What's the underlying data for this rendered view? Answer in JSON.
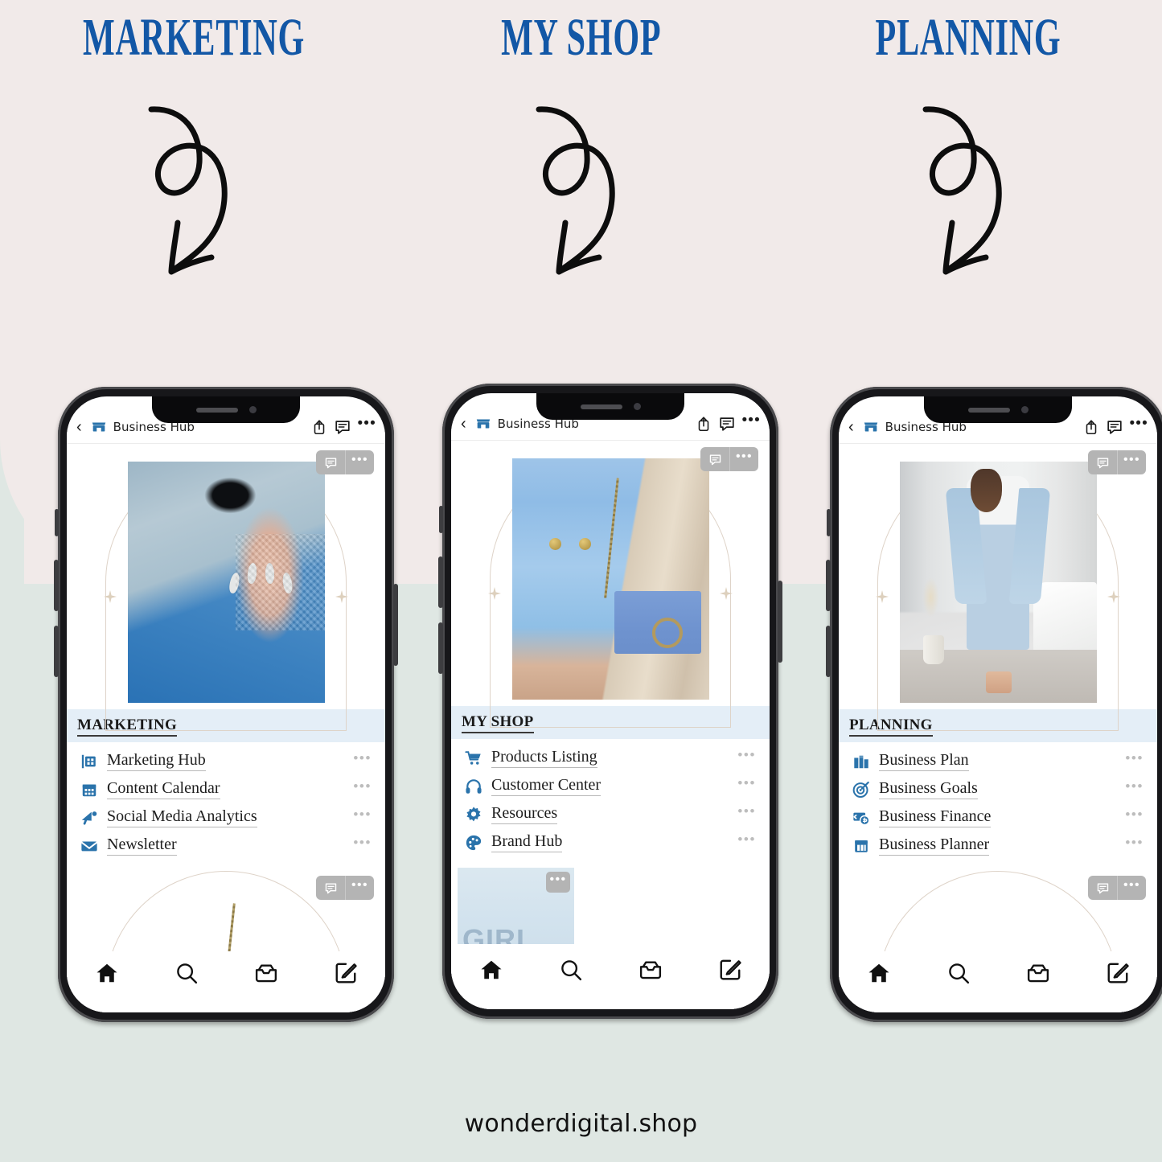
{
  "background": {
    "top_color": "#f1eae9",
    "bottom_color": "#dfe7e3"
  },
  "accent": {
    "heading_blue": "#1257a6",
    "icon_blue": "#2a73ab",
    "section_bar": "#e4eef7"
  },
  "headings": [
    {
      "label": "MARKETING"
    },
    {
      "label": "MY SHOP"
    },
    {
      "label": "PLANNING"
    }
  ],
  "arrow_icon": "curly-arrow-down-left-icon",
  "phones": [
    {
      "id": "phone-1",
      "header": {
        "back_icon": "chevron-left-icon",
        "shop_icon": "storefront-icon",
        "title": "Business Hub",
        "share_icon": "share-icon",
        "comment_icon": "comment-icon",
        "more_icon": "ellipsis-icon",
        "more_label": "•••"
      },
      "card": {
        "comment_icon": "comment-icon",
        "more_label": "•••",
        "photo_alt": "blue-coat-and-handbag-photo"
      },
      "section": {
        "title": "MARKETING",
        "items": [
          {
            "label": "Marketing Hub",
            "icon": "grid-board-icon",
            "menu_label": "•••"
          },
          {
            "label": "Content Calendar",
            "icon": "calendar-icon",
            "menu_label": "•••"
          },
          {
            "label": "Social Media Analytics",
            "icon": "megaphone-icon",
            "menu_label": "•••"
          },
          {
            "label": "Newsletter",
            "icon": "envelope-icon",
            "menu_label": "•••"
          }
        ]
      },
      "second_card": {
        "comment_icon": "comment-icon",
        "more_label": "•••",
        "photo_alt": "blue-coat-with-purse-photo"
      },
      "tabs": [
        {
          "icon": "home-icon",
          "active": true
        },
        {
          "icon": "search-icon",
          "active": false
        },
        {
          "icon": "inbox-icon",
          "active": false
        },
        {
          "icon": "compose-icon",
          "active": false
        }
      ],
      "home_indicator": false
    },
    {
      "id": "phone-2",
      "header": {
        "back_icon": "chevron-left-icon",
        "shop_icon": "storefront-icon",
        "title": "Business Hub",
        "share_icon": "share-icon",
        "comment_icon": "comment-icon",
        "more_icon": "ellipsis-icon",
        "more_label": "•••"
      },
      "card": {
        "comment_icon": "comment-icon",
        "more_label": "•••",
        "photo_alt": "blue-coat-with-purse-photo"
      },
      "section": {
        "title": "MY SHOP",
        "items": [
          {
            "label": "Products Listing",
            "icon": "shopping-cart-icon",
            "menu_label": "•••"
          },
          {
            "label": "Customer Center",
            "icon": "headphones-icon",
            "menu_label": "•••"
          },
          {
            "label": "Resources",
            "icon": "gear-icon",
            "menu_label": "•••"
          },
          {
            "label": "Brand Hub",
            "icon": "palette-icon",
            "menu_label": "•••"
          }
        ]
      },
      "tile": {
        "text": "GIRL",
        "more_label": "•••"
      },
      "tabs": [
        {
          "icon": "home-icon",
          "active": true
        },
        {
          "icon": "search-icon",
          "active": false
        },
        {
          "icon": "inbox-icon",
          "active": false
        },
        {
          "icon": "compose-icon",
          "active": false
        }
      ],
      "home_indicator": true
    },
    {
      "id": "phone-3",
      "header": {
        "back_icon": "chevron-left-icon",
        "shop_icon": "storefront-icon",
        "title": "Business Hub",
        "share_icon": "share-icon",
        "comment_icon": "comment-icon",
        "more_icon": "ellipsis-icon",
        "more_label": "•••"
      },
      "card": {
        "comment_icon": "comment-icon",
        "more_label": "•••",
        "photo_alt": "woman-in-light-blue-suit-photo"
      },
      "section": {
        "title": "PLANNING",
        "items": [
          {
            "label": "Business Plan",
            "icon": "bar-chart-icon",
            "menu_label": "•••"
          },
          {
            "label": "Business Goals",
            "icon": "target-icon",
            "menu_label": "•••"
          },
          {
            "label": "Business Finance",
            "icon": "money-card-icon",
            "menu_label": "•••"
          },
          {
            "label": "Business Planner",
            "icon": "calendar-icon",
            "menu_label": "•••"
          }
        ]
      },
      "second_card": {
        "comment_icon": "comment-icon",
        "more_label": "•••",
        "photo_alt": "blue-coat-and-handbag-photo"
      },
      "tabs": [
        {
          "icon": "home-icon",
          "active": true
        },
        {
          "icon": "search-icon",
          "active": false
        },
        {
          "icon": "inbox-icon",
          "active": false
        },
        {
          "icon": "compose-icon",
          "active": false
        }
      ],
      "home_indicator": false
    }
  ],
  "footer": {
    "text": "wonderdigital.shop"
  }
}
